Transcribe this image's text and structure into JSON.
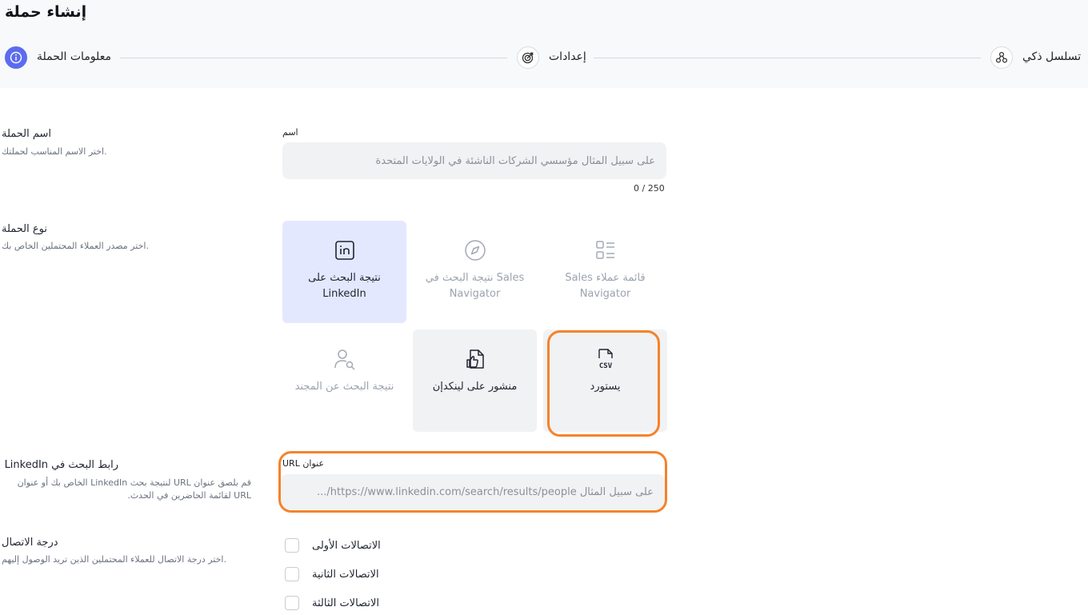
{
  "page": {
    "title": "إنشاء حملة"
  },
  "steps": [
    {
      "label": "معلومات الحملة",
      "icon": "info-icon",
      "active": true
    },
    {
      "label": "إعدادات",
      "icon": "target-icon",
      "active": false
    },
    {
      "label": "تسلسل ذكي",
      "icon": "network-icon",
      "active": false
    }
  ],
  "campaign_name": {
    "title": "اسم الحملة",
    "description": "اختر الاسم المناسب لحملتك.",
    "field_label": "اسم",
    "placeholder": "على سبيل المثال مؤسسي الشركات الناشئة في الولايات المتحدة",
    "value": "",
    "counter": "0 / 250"
  },
  "campaign_type": {
    "title": "نوع الحملة",
    "description": "اختر مصدر العملاء المحتملين الخاص بك.",
    "options": [
      {
        "label": "نتيجة البحث على LinkedIn",
        "icon": "linkedin-icon",
        "state": "selected"
      },
      {
        "label": "نتيجة البحث في Sales Navigator",
        "icon": "compass-icon",
        "state": "disabled"
      },
      {
        "label": "Sales قائمة عملاء Navigator",
        "icon": "list-icon",
        "state": "disabled"
      },
      {
        "label": "نتيجة البحث عن المجند",
        "icon": "user-search-icon",
        "state": "disabled"
      },
      {
        "label": "منشور على لينكدإن",
        "icon": "thumbs-up-doc-icon",
        "state": "available"
      },
      {
        "label": "يستورد",
        "icon": "csv-file-icon",
        "state": "available"
      }
    ]
  },
  "linkedin_url": {
    "title": "رابط البحث في LinkedIn",
    "description": "قم بلصق عنوان URL لنتيجة بحث LinkedIn الخاص بك أو عنوان URL لقائمة الحاضرين في الحدث.",
    "field_label": "عنوان URL",
    "placeholder": "على سبيل المثال https://www.linkedin.com/search/results/people/...",
    "value": ""
  },
  "connection_degree": {
    "title": "درجة الاتصال",
    "description": "اختر درجة الاتصال للعملاء المحتملين الذين تريد الوصول إليهم.",
    "options": [
      {
        "label": "الاتصالات الأولى",
        "checked": false
      },
      {
        "label": "الاتصالات الثانية",
        "checked": false
      },
      {
        "label": "الاتصالات الثالثة",
        "checked": false
      }
    ]
  },
  "colors": {
    "accent": "#5b6cf0",
    "highlight": "#f5832b",
    "selected_card": "#e4e8ff"
  }
}
